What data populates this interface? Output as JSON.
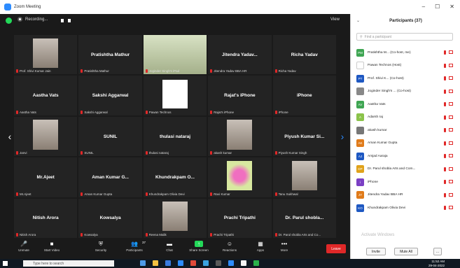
{
  "window": {
    "title": "Zoom Meeting",
    "controls": [
      "–",
      "☐",
      "✕"
    ]
  },
  "topbar": {
    "recording": "Recording...",
    "view": "View"
  },
  "tiles": [
    {
      "name": "",
      "label": "Prof. Shivi Kumar Jain",
      "type": "photo"
    },
    {
      "name": "Pratishtha Mathur",
      "label": "Pratishtha Mathur",
      "type": "text"
    },
    {
      "name": "",
      "label": "Joginder Singh's iPad",
      "type": "photo-active"
    },
    {
      "name": "Jitendra Yadav...",
      "label": "Jitendra Yadav BBA HR",
      "type": "text"
    },
    {
      "name": "Richa Yadav",
      "label": "Richa Yadav",
      "type": "text"
    },
    {
      "name": "Aastha Vats",
      "label": "Aastha Vats",
      "type": "text"
    },
    {
      "name": "Sakshi Aggarwal",
      "label": "Sakshi Aggarwal",
      "type": "text"
    },
    {
      "name": "",
      "label": "Pawan Technos",
      "type": "logo"
    },
    {
      "name": "Rajat's iPhone",
      "label": "Rajat's iPhone",
      "type": "text"
    },
    {
      "name": "iPhone",
      "label": "iPhone",
      "type": "text"
    },
    {
      "name": "",
      "label": "Janvi",
      "type": "photo"
    },
    {
      "name": "SUNIL",
      "label": "SUNIL",
      "type": "text"
    },
    {
      "name": "thulasi nataraj",
      "label": "thulasi nataraj",
      "type": "text"
    },
    {
      "name": "",
      "label": "akash kumar",
      "type": "photo"
    },
    {
      "name": "Piyush Kumar Si...",
      "label": "Piyush Kumar Singh",
      "type": "text"
    },
    {
      "name": "Mr.Ajeet",
      "label": "Mr.Ajeet",
      "type": "text"
    },
    {
      "name": "Aman Kumar G...",
      "label": "Aman Kumar Gupta",
      "type": "text"
    },
    {
      "name": "Khundrakpam O...",
      "label": "Khundrakpam Olivia Devi",
      "type": "text"
    },
    {
      "name": "",
      "label": "Ravi Kumar",
      "type": "flower"
    },
    {
      "name": "",
      "label": "Tanu Sukhwal",
      "type": "photo"
    },
    {
      "name": "Nitish Arora",
      "label": "Nitish Arora",
      "type": "text"
    },
    {
      "name": "Kowsalya",
      "label": "Kowsalya",
      "type": "text"
    },
    {
      "name": "",
      "label": "Reena Malik",
      "type": "photo"
    },
    {
      "name": "Prachi Tripathi",
      "label": "Prachi Tripathi",
      "type": "text"
    },
    {
      "name": "Dr. Parul shobla...",
      "label": "Dr. Parul shobla Arts and Co...",
      "type": "text"
    }
  ],
  "toolbar": [
    {
      "label": "Unmute",
      "icon": "🎤"
    },
    {
      "label": "Start Video",
      "icon": "■"
    },
    {
      "label": "Security",
      "icon": "⛨"
    },
    {
      "label": "Participants",
      "icon": "👥"
    },
    {
      "label": "Chat",
      "icon": "▬"
    },
    {
      "label": "Share Screen",
      "icon": "↑"
    },
    {
      "label": "Reactions",
      "icon": "☺"
    },
    {
      "label": "Apps",
      "icon": "▦"
    },
    {
      "label": "More",
      "icon": "•••"
    }
  ],
  "participants_count": "37",
  "leave_label": "Leave",
  "panel": {
    "title": "Participants (37)",
    "search_placeholder": "Find a participant",
    "items": [
      {
        "initials": "PM",
        "color": "#3ea552",
        "name": "Pratishtha M... (Co-host, me)"
      },
      {
        "initials": "",
        "color": "#ffffff",
        "name": "Pawan Technos (Host)"
      },
      {
        "initials": "PT",
        "color": "#1e58c2",
        "name": "Prof. Shivi K... (Co-host)"
      },
      {
        "initials": "",
        "color": "#888888",
        "name": "Joginder Singh's ... (Co-host)"
      },
      {
        "initials": "AV",
        "color": "#3ea552",
        "name": "Aastha Vats"
      },
      {
        "initials": "A",
        "color": "#8bc34a",
        "name": "Adarsh raj"
      },
      {
        "initials": "",
        "color": "#777777",
        "name": "akash kumar"
      },
      {
        "initials": "AK",
        "color": "#e07b1a",
        "name": "Aman Kumar Gupta"
      },
      {
        "initials": "AJ",
        "color": "#1e58c2",
        "name": "Amjad Aaraja"
      },
      {
        "initials": "DP",
        "color": "#e0a21a",
        "name": "Dr. Parul shobla Arts and Com..."
      },
      {
        "initials": "i",
        "color": "#7b3fc4",
        "name": "iPhone"
      },
      {
        "initials": "JY",
        "color": "#e07b1a",
        "name": "Jitendra Yadav BBA HR"
      },
      {
        "initials": "KO",
        "color": "#1e58c2",
        "name": "Khundrakpam Olivia Devi"
      }
    ],
    "invite_label": "Invite",
    "mute_all_label": "Mute All",
    "more_label": "..."
  },
  "activation": "Activate Windows",
  "taskbar": {
    "search_placeholder": "Type here to search",
    "time": "11:52 AM",
    "date": "29-04-2022",
    "app_colors": [
      "#4f9be8",
      "#f5c242",
      "#3a7be0",
      "#2d8cff",
      "#e04a3a",
      "#3aa3e0",
      "#5a5a5a",
      "#2d8cff",
      "#f5f5f5",
      "#2ab24a"
    ]
  }
}
